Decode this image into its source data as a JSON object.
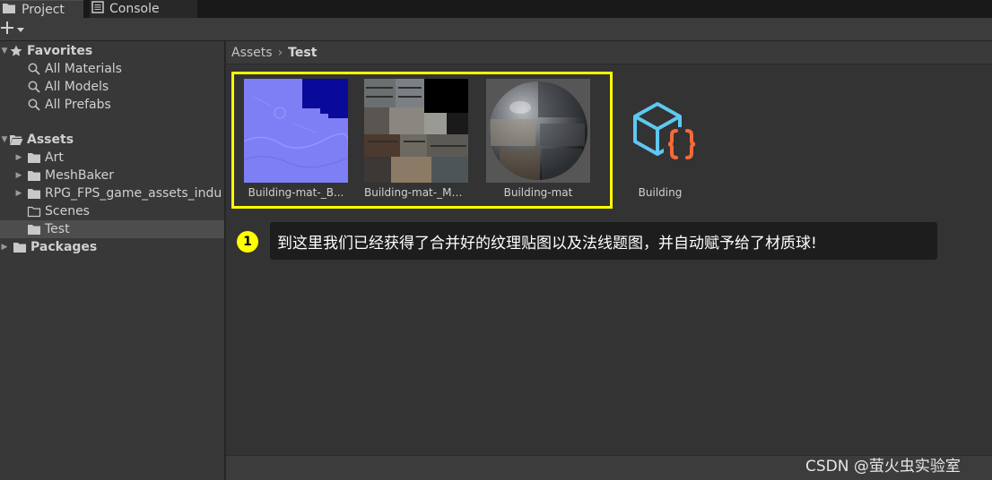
{
  "tabs": [
    {
      "label": "Project",
      "icon": "folder-icon"
    },
    {
      "label": "Console",
      "icon": "console-icon"
    }
  ],
  "toolbar": {
    "create_label": "+"
  },
  "sidebar": {
    "favorites": {
      "label": "Favorites",
      "items": [
        "All Materials",
        "All Models",
        "All Prefabs"
      ]
    },
    "assets": {
      "label": "Assets",
      "items": [
        "Art",
        "MeshBaker",
        "RPG_FPS_game_assets_indu",
        "Scenes",
        "Test"
      ]
    },
    "packages": {
      "label": "Packages"
    }
  },
  "breadcrumb": {
    "root": "Assets",
    "separator": "›",
    "current": "Test"
  },
  "assets": [
    {
      "label": "Building-mat-_B..."
    },
    {
      "label": "Building-mat-_Ma..."
    },
    {
      "label": "Building-mat"
    },
    {
      "label": "Building"
    }
  ],
  "annotation": {
    "number": "1",
    "text": "到这里我们已经获得了合并好的纹理贴图以及法线题图，并自动赋予给了材质球!"
  },
  "watermark": "CSDN @萤火虫实验室",
  "colors": {
    "highlight": "#ffff00",
    "selection": "#4d4d4d",
    "script_cyan": "#5ec8f0",
    "script_orange": "#f26b3a"
  }
}
